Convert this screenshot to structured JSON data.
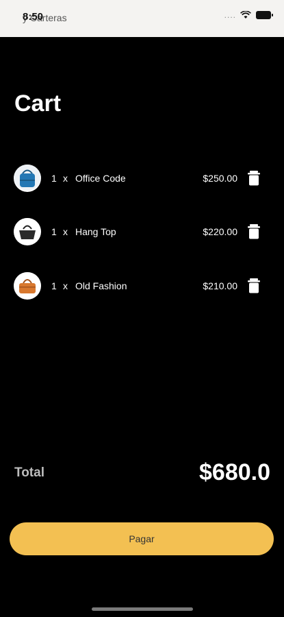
{
  "status_bar": {
    "time": "8:50",
    "app_name": "y Carteras",
    "dots": "....",
    "wifi_icon": "wifi-icon",
    "battery_icon": "battery-icon"
  },
  "page": {
    "title": "Cart"
  },
  "cart": {
    "items": [
      {
        "qty": "1",
        "times": "x",
        "name": "Office Code",
        "price": "$250.00",
        "thumb_icon": "blue-bag-icon"
      },
      {
        "qty": "1",
        "times": "x",
        "name": "Hang Top",
        "price": "$220.00",
        "thumb_icon": "black-bag-icon"
      },
      {
        "qty": "1",
        "times": "x",
        "name": "Old Fashion",
        "price": "$210.00",
        "thumb_icon": "orange-bag-icon"
      }
    ],
    "delete_icon": "trash-icon"
  },
  "summary": {
    "total_label": "Total",
    "total_value": "$680.0"
  },
  "actions": {
    "pay_label": "Pagar"
  },
  "colors": {
    "background": "#000000",
    "accent": "#f3c052",
    "status_bar_bg": "#f4f3f1"
  }
}
